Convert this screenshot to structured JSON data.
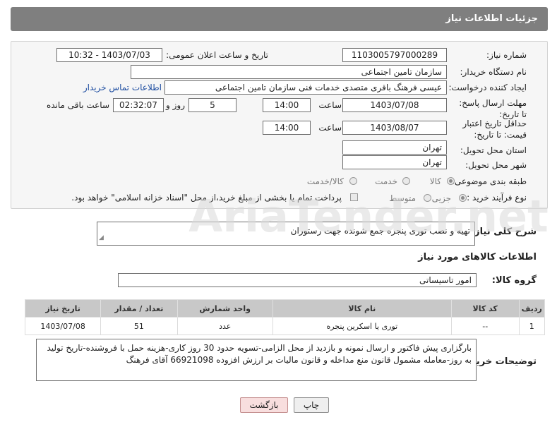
{
  "header": {
    "title": "جزئیات اطلاعات نیاز"
  },
  "form": {
    "need_number_label": "شماره نیاز:",
    "need_number": "1103005797000289",
    "announce_label": "تاریخ و ساعت اعلان عمومی:",
    "announce_value": "1403/07/03 - 10:32",
    "buyer_org_label": "نام دستگاه خریدار:",
    "buyer_org": "سازمان تامین اجتماعی",
    "creator_label": "ایجاد کننده درخواست:",
    "creator": "عیسی فرهنگ باقری متصدی خدمات فنی سازمان تامین اجتماعی",
    "contact_link": "اطلاعات تماس خریدار",
    "reply_deadline_label": "مهلت ارسال پاسخ: تا تاریخ:",
    "reply_date": "1403/07/08",
    "time_label": "ساعت",
    "reply_time": "14:00",
    "days_value": "5",
    "days_label": "روز و",
    "remaining_value": "02:32:07",
    "remaining_label": "ساعت باقی مانده",
    "price_deadline_label": "حداقل تاریخ اعتبار قیمت: تا تاریخ:",
    "price_date": "1403/08/07",
    "price_time": "14:00",
    "province_label": "استان محل تحویل:",
    "province": "تهران",
    "city_label": "شهر محل تحویل:",
    "city": "تهران",
    "category_label": "طبقه بندی موضوعی:",
    "category_options": [
      "کالا",
      "خدمت",
      "کالا/خدمت"
    ],
    "process_label": "نوع فرآیند خرید :",
    "process_options": [
      "جزیی",
      "متوسط"
    ],
    "payment_note": "پرداخت تمام یا بخشی از مبلغ خرید،از محل \"اسناد خزانه اسلامی\" خواهد بود."
  },
  "description": {
    "label": "شرح کلی نیاز:",
    "text": "تهیه و نصب توری پنجره جمع شونده جهت رستوران"
  },
  "goods": {
    "section_title": "اطلاعات کالاهای مورد نیاز",
    "group_label": "گروه کالا:",
    "group_value": "امور تاسیساتی",
    "columns": [
      "ردیف",
      "کد کالا",
      "نام کالا",
      "واحد شمارش",
      "تعداد / مقدار",
      "تاریخ نیاز"
    ],
    "rows": [
      {
        "row": "1",
        "code": "--",
        "name": "توری یا اسکرین پنجره",
        "unit": "عدد",
        "qty": "51",
        "date": "1403/07/08"
      }
    ]
  },
  "buyer_notes": {
    "label": "توضیحات خریدار:",
    "text": "بارگزاری پیش فاکتور و ارسال نمونه و بازدید از محل الزامی-تسویه حدود 30 روز کاری-هزینه حمل با فروشنده-تاریخ تولید به روز-معامله مشمول قانون منع مداخله و قانون مالیات بر ارزش افزوده   66921098 آقای فرهنگ"
  },
  "buttons": {
    "print": "چاپ",
    "back": "بازگشت"
  },
  "watermark": {
    "text": "AriaTender.net"
  },
  "colors": {
    "header": "#7f7f7f",
    "link": "#1f4ea1",
    "table_header": "#c8c8c8"
  }
}
